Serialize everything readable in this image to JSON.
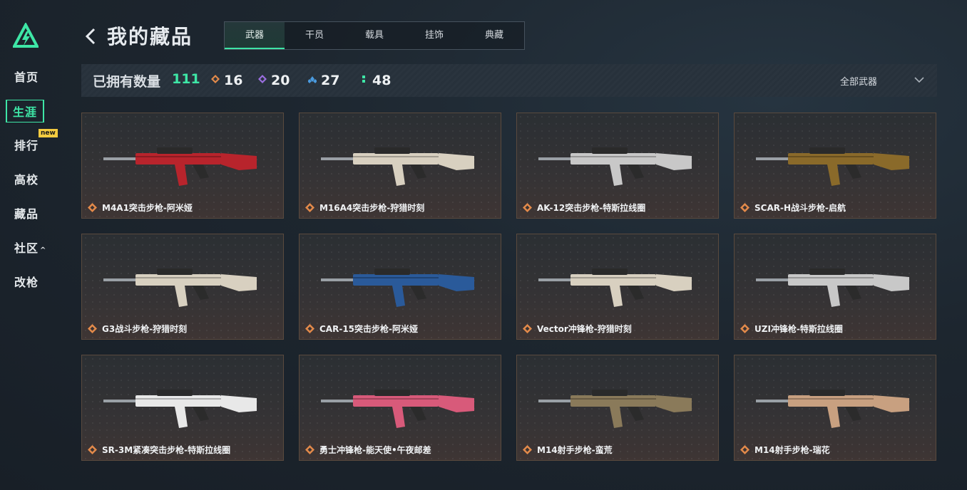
{
  "sidebar": {
    "items": [
      {
        "label": "首页"
      },
      {
        "label": "生涯"
      },
      {
        "label": "排行",
        "badge": "new"
      },
      {
        "label": "高校"
      },
      {
        "label": "藏品"
      },
      {
        "label": "社区",
        "caret": "^"
      },
      {
        "label": "改枪"
      }
    ],
    "accent": "#3ee6a6"
  },
  "header": {
    "title": "我的藏品",
    "tabs": [
      {
        "label": "武器",
        "active": true
      },
      {
        "label": "干员"
      },
      {
        "label": "载具"
      },
      {
        "label": "挂饰"
      },
      {
        "label": "典藏"
      }
    ]
  },
  "stats": {
    "owned_label": "已拥有数量",
    "owned_count": "111",
    "rarities": [
      {
        "icon": "orange-diamond-icon",
        "color": "#e38a4a",
        "count": "16"
      },
      {
        "icon": "purple-diamond-icon",
        "color": "#9b6fe0",
        "count": "20"
      },
      {
        "icon": "blue-diamond-icon",
        "color": "#4a9be0",
        "count": "27"
      },
      {
        "icon": "green-dots-icon",
        "color": "#3ee6a6",
        "count": "48"
      }
    ],
    "filter_label": "全部武器"
  },
  "weapons": [
    {
      "name": "M4A1突击步枪-阿米娅",
      "color": "#b8242c"
    },
    {
      "name": "M16A4突击步枪-狩猎时刻",
      "color": "#d8d0c0"
    },
    {
      "name": "AK-12突击步枪-特斯拉线圈",
      "color": "#c8c8c8"
    },
    {
      "name": "SCAR-H战斗步枪-启航",
      "color": "#8a6a2a"
    },
    {
      "name": "G3战斗步枪-狩猎时刻",
      "color": "#d8d0c0"
    },
    {
      "name": "CAR-15突击步枪-阿米娅",
      "color": "#2a5a9a"
    },
    {
      "name": "Vector冲锋枪-狩猎时刻",
      "color": "#d8d0c0"
    },
    {
      "name": "UZI冲锋枪-特斯拉线圈",
      "color": "#c8c8c8"
    },
    {
      "name": "SR-3M紧凑突击步枪-特斯拉线圈",
      "color": "#e8e8e8"
    },
    {
      "name": "勇士冲锋枪-能天使•午夜邮差",
      "color": "#d85a7a"
    },
    {
      "name": "M14射手步枪-蛮荒",
      "color": "#8a7a5a"
    },
    {
      "name": "M14射手步枪-瑞花",
      "color": "#c8a080"
    }
  ]
}
